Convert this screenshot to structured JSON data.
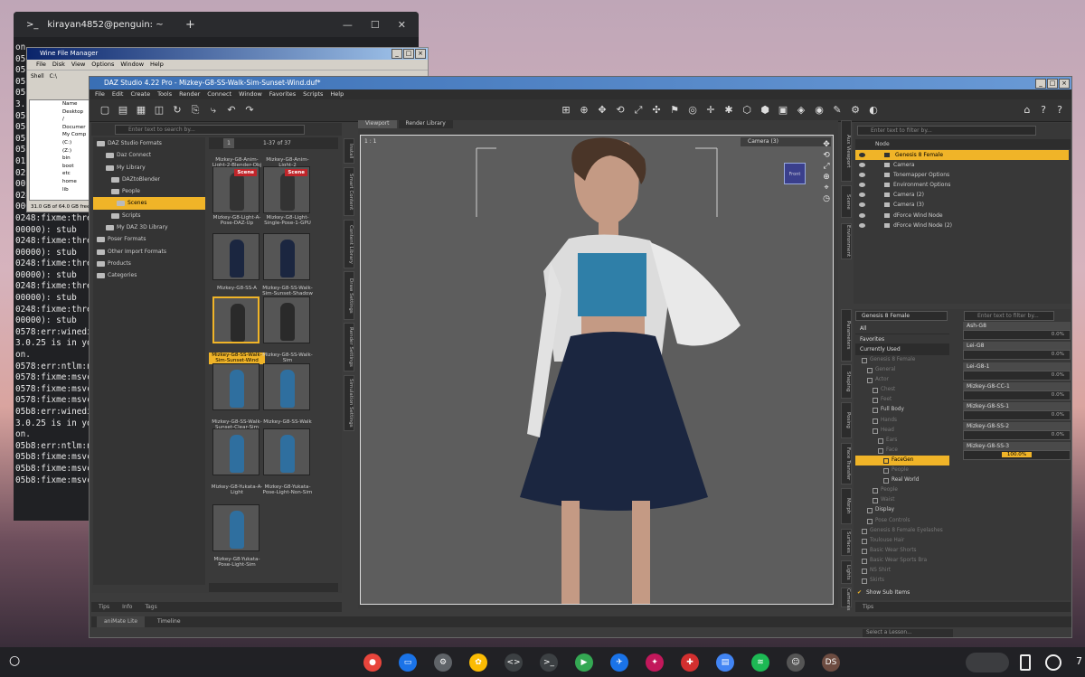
{
  "terminal": {
    "tab": "kirayan4852@penguin: ~",
    "prompt": ">_",
    "newtab": "+",
    "minimize": "—",
    "maximize": "☐",
    "close": "✕",
    "lines": [
      "on",
      "05",
      "05",
      "05",
      "05",
      "3.",
      "05",
      "05",
      "05",
      "05",
      "01",
      "02",
      "00",
      "0248:fixme:threa",
      "00000): stub",
      "0248:fixme:threa",
      "00000): stub",
      "0248:fixme:threa",
      "00000): stub",
      "0248:fixme:threa",
      "00000): stub",
      "0248:fixme:threa",
      "00000): stub",
      "0248:fixme:threa",
      "00000): stub",
      "0578:err:winedia",
      "3.0.25 is in you",
      "on.",
      "0578:err:ntlm:ntl",
      "0578:fixme:msvcr",
      "0578:fixme:msvcr",
      "0578:fixme:msvcr",
      "05b8:err:winedia",
      "3.0.25 is in you",
      "on.",
      "05b8:err:ntlm:ntl",
      "05b8:fixme:msvcr",
      "05b8:fixme:msvcr",
      "05b8:fixme:msvcr"
    ]
  },
  "wine": {
    "title": "Wine File Manager",
    "menu": [
      "File",
      "Disk",
      "View",
      "Options",
      "Window",
      "Help"
    ],
    "drives": [
      "Shell",
      "C:\\"
    ],
    "tree": [
      "Name",
      "Desktop",
      "/",
      "Documer",
      "My Comp",
      "(C:)",
      "(Z:)",
      "bin",
      "boot",
      "etc",
      "home",
      "lib"
    ],
    "status": "31.0 GB of 64.0 GB free"
  },
  "daz": {
    "title": "DAZ Studio 4.22 Pro - Mizkey-G8-SS-Walk-Sim-Sunset-Wind.duf*",
    "menu": [
      "File",
      "Edit",
      "Create",
      "Tools",
      "Render",
      "Connect",
      "Window",
      "Favorites",
      "Scripts",
      "Help"
    ],
    "search_placeholder": "Enter text to search by...",
    "library": [
      "DAZ Studio Formats",
      "Daz Connect",
      "My Library",
      "DAZtoBlender",
      "People",
      "Scenes",
      "Scripts",
      "My DAZ 3D Library",
      "Poser Formats",
      "Other Import Formats",
      "Products",
      "Categories"
    ],
    "pager": {
      "page": "1",
      "range": "1-37 of 37"
    },
    "thumbs": [
      "Mizkey-G8-Anim-Light-2-Blender-Obj",
      "Mizkey-G8-Anim-Light-2",
      "Mizkey-G8-Light-A-Pose-DAZ-Up",
      "Mizkey-G8-Light-Single-Pose-1-GPU",
      "Mizkey-G8-SS-A",
      "Mizkey-G8-SS-Walk-Sim-Sunset-Shadow",
      "Mizkey-G8-SS-Walk-Sim-Sunset-Wind",
      "Mizkey-G8-SS-Walk-Sim",
      "Mizkey-G8-SS-Walk-Sunset-Clear-Sim",
      "Mizkey-G8-SS-Walk",
      "Mizkey-G8-Yukata-A-Light",
      "Mizkey-G8-Yukata-Pose-Light-Non-Sim",
      "Mizkey-G8-Yukata-Pose-Light-Sim"
    ],
    "badge": "Scene",
    "left_bottom_tabs": [
      "Tips",
      "Info",
      "Tags"
    ],
    "left_vtabs": [
      "Install",
      "Smart Content",
      "Content Library",
      "Draw Settings",
      "Render Settings",
      "Simulation Settings"
    ],
    "viewport_tabs": [
      "Viewport",
      "Render Library"
    ],
    "viewport_label": "1 : 1",
    "camera": "Camera (3)",
    "cube": "Front",
    "bottom_tabs": [
      "aniMate Lite",
      "Timeline"
    ],
    "filter_placeholder": "Enter text to filter by...",
    "scene_header": "Node",
    "scene_nodes": [
      "Genesis 8 Female",
      "Camera",
      "Tonemapper Options",
      "Environment Options",
      "Camera (2)",
      "Camera (3)",
      "dForce Wind Node",
      "dForce Wind Node (2)"
    ],
    "right_vtabs_top": [
      "Aux Viewport",
      "Scene",
      "Environment"
    ],
    "right_vtabs_bottom": [
      "Parameters",
      "Shaping",
      "Posing",
      "Face Transfer",
      "Morph",
      "Surfaces",
      "Lights",
      "Cameras"
    ],
    "figure_select": "Genesis 8 Female",
    "param_tabs": [
      "All",
      "Favorites",
      "Currently Used"
    ],
    "param_tree": [
      "Genesis 8 Female",
      "General",
      "Actor",
      "Chest",
      "Feet",
      "Full Body",
      "Hands",
      "Head",
      "Ears",
      "Face",
      "FaceGen",
      "People",
      "Real World",
      "People",
      "Waist",
      "Display",
      "Pose Controls",
      "Genesis 8 Female Eyelashes",
      "Toulouse Hair",
      "Basic Wear Shorts",
      "Basic Wear Sports Bra",
      "NS Shirt",
      "Skirts"
    ],
    "show_sub": "Show Sub Items",
    "tips_tab": "Tips",
    "sliders": [
      {
        "name": "Ash-G8",
        "value": "0.0%"
      },
      {
        "name": "Lei-G8",
        "value": "0.0%"
      },
      {
        "name": "Lei-G8-1",
        "value": "0.0%"
      },
      {
        "name": "Mizkey-G8-CC-1",
        "value": "0.0%"
      },
      {
        "name": "Mizkey-G8-SS-1",
        "value": "0.0%"
      },
      {
        "name": "Mizkey-G8-SS-2",
        "value": "0.0%"
      },
      {
        "name": "Mizkey-G8-SS-3",
        "value": "100.0%"
      }
    ],
    "lesson": "Select a Lesson..."
  },
  "shelf": {
    "launcher": "○",
    "apps": [
      "chrome",
      "files",
      "settings",
      "photos",
      "text",
      "terminal",
      "play",
      "app",
      "app",
      "app",
      "docs",
      "spotify",
      "wine",
      "DS"
    ],
    "time": "7"
  }
}
